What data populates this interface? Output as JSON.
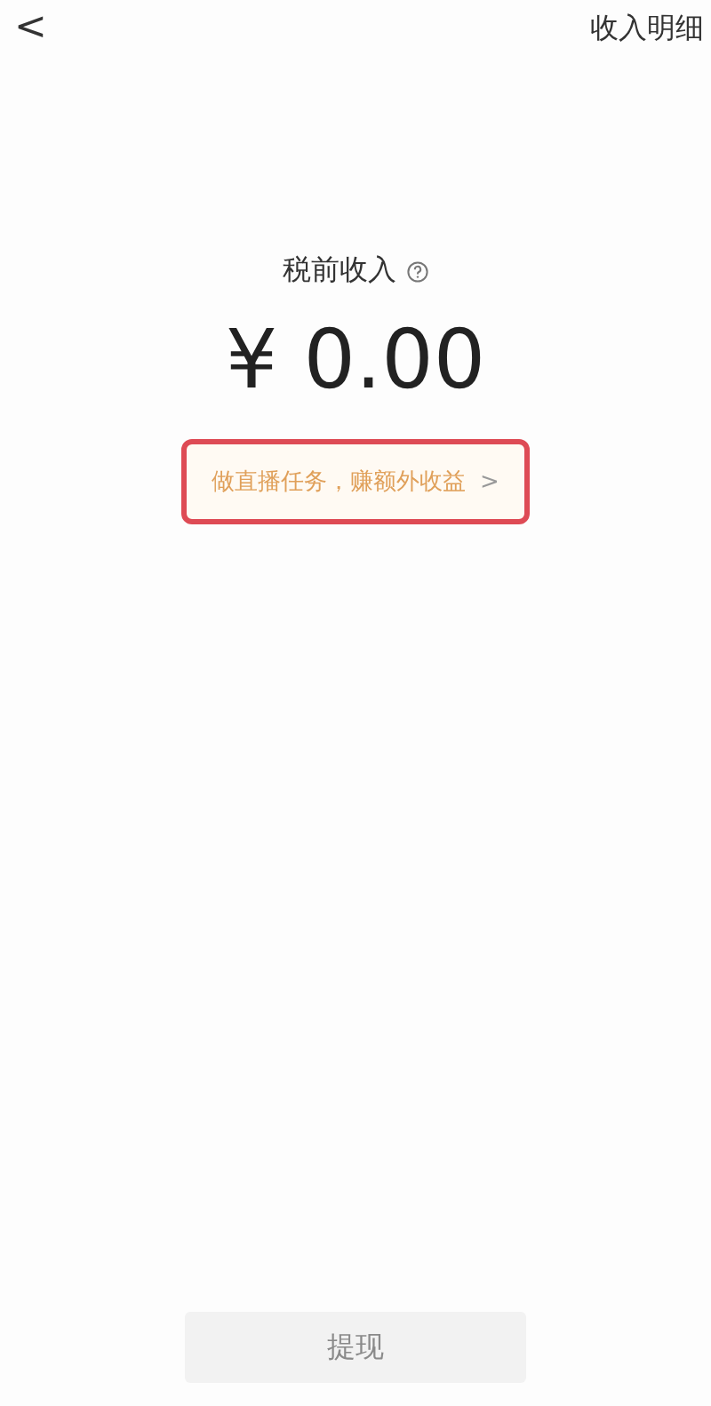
{
  "header": {
    "back": "<",
    "action": "收入明细"
  },
  "income": {
    "label": "税前收入",
    "help_icon": true,
    "amount": "¥ 0.00"
  },
  "promo": {
    "text": "做直播任务，赚额外收益",
    "chevron": ">",
    "highlighted": true
  },
  "withdraw_button": {
    "label": "提现",
    "disabled": true
  }
}
